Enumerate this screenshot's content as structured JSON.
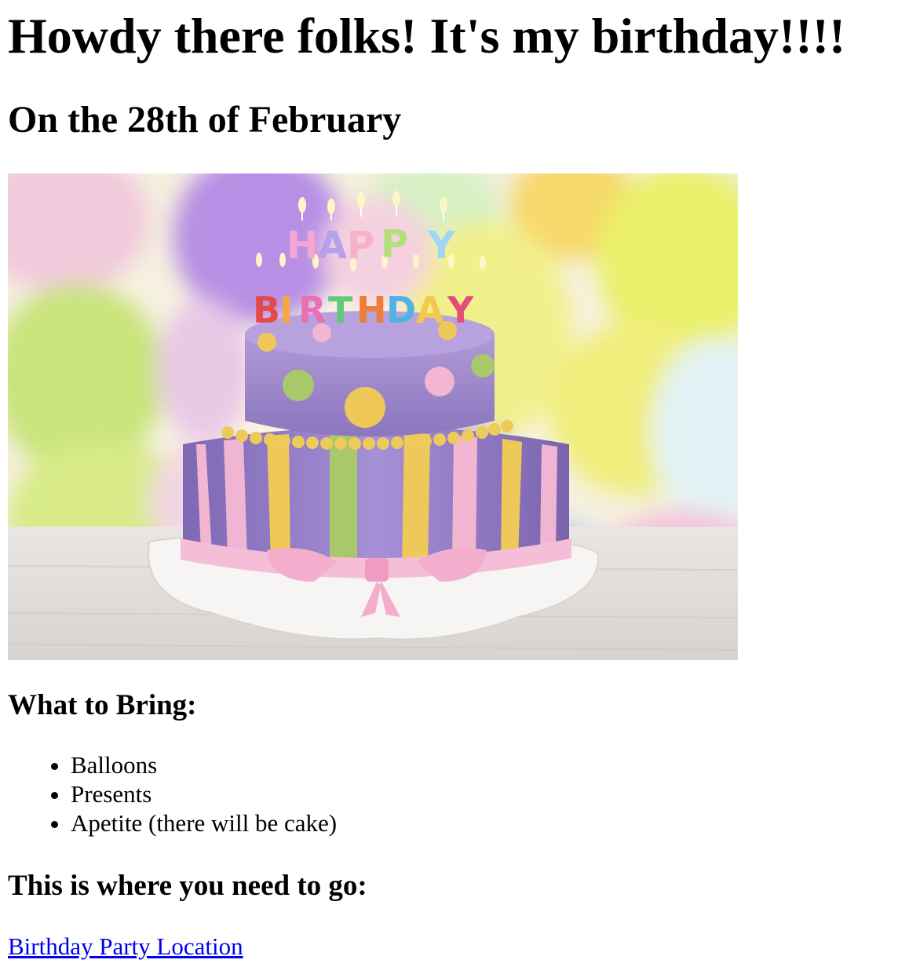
{
  "header": {
    "title": "Howdy there folks! It's my birthday!!!!",
    "subtitle": "On the 28th of February"
  },
  "image": {
    "name": "birthday-cake-image",
    "candle_letters": "HAPPY BIRTHDAY"
  },
  "bring": {
    "heading": "What to Bring:",
    "items": [
      "Balloons",
      "Presents",
      "Apetite (there will be cake)"
    ]
  },
  "location": {
    "heading": "This is where you need to go:",
    "link_text": "Birthday Party Location"
  },
  "colors": {
    "link": "#0000ee",
    "text": "#000000",
    "cake_purple": "#9b84c9",
    "cake_pink": "#f2b6d2",
    "cake_yellow": "#efc85a",
    "cake_green": "#a9c86a"
  }
}
